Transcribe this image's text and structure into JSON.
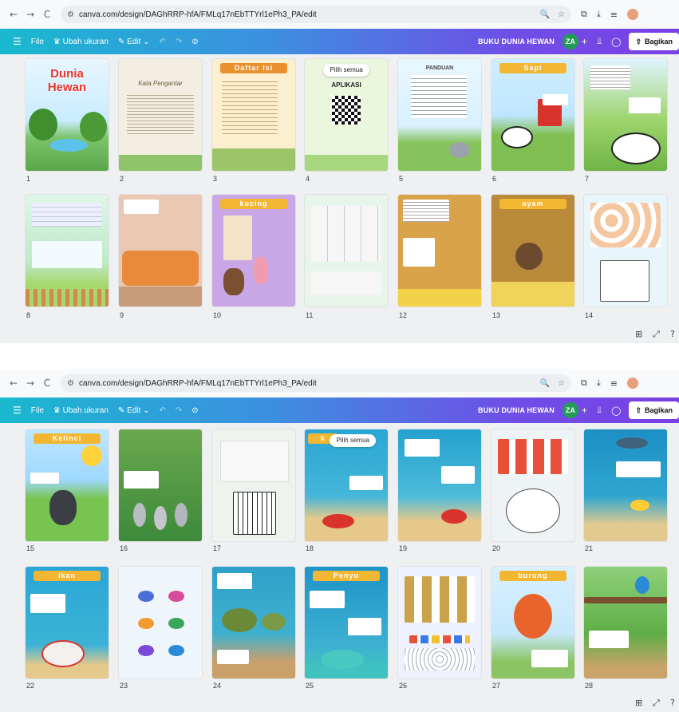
{
  "browser": {
    "url": "canva.com/design/DAGhRRP-hfA/FMLq17nEbTTYrl1ePh3_PA/edit",
    "url2": "canva.com/design/DAGhRRP-hfA/FMLq17nEbTTYrl1ePh3_PA/edit",
    "back_icon": "←",
    "forward_icon": "→",
    "reload_icon": "C",
    "tune_icon": "⚙",
    "zoom_icon": "🔍",
    "star_icon": "☆",
    "ext_icon": "⧉",
    "download_icon": "⤓",
    "tabs_icon": "≡"
  },
  "toolbar": {
    "menu_icon": "☰",
    "file": "File",
    "resize": "Ubah ukuran",
    "edit": "Edit",
    "undo": "↶",
    "redo": "↷",
    "saved_icon": "⊘",
    "doc_name": "BUKU DUNIA HEWAN",
    "avatar": "ZA",
    "plus": "+",
    "chart_icon": "⫫",
    "comment_icon": "◯",
    "share": "Bagikan",
    "share_icon": "⇧"
  },
  "screen1": {
    "pages": [
      {
        "num": "1",
        "title": "Dunia Hewan"
      },
      {
        "num": "2",
        "title": "Kata Pengantar"
      },
      {
        "num": "3",
        "title": "Daftar Isi"
      },
      {
        "num": "4",
        "button": "Pilih semua",
        "text": "APLIKASI"
      },
      {
        "num": "5",
        "title": "PANDUAN"
      },
      {
        "num": "6",
        "title": "Sapi"
      },
      {
        "num": "7",
        "title": ""
      },
      {
        "num": "8",
        "title": ""
      },
      {
        "num": "9",
        "title": ""
      },
      {
        "num": "10",
        "title": "kucing"
      },
      {
        "num": "11",
        "title": ""
      },
      {
        "num": "12",
        "title": ""
      },
      {
        "num": "13",
        "title": "ayam"
      },
      {
        "num": "14",
        "title": ""
      }
    ]
  },
  "screen2": {
    "pages": [
      {
        "num": "15",
        "title": "Kelinci"
      },
      {
        "num": "16",
        "title": ""
      },
      {
        "num": "17",
        "title": ""
      },
      {
        "num": "18",
        "title": "k",
        "button": "Pilih semua"
      },
      {
        "num": "19",
        "title": ""
      },
      {
        "num": "20",
        "title": ""
      },
      {
        "num": "21",
        "title": ""
      },
      {
        "num": "22",
        "title": "ikan"
      },
      {
        "num": "23",
        "title": ""
      },
      {
        "num": "24",
        "title": ""
      },
      {
        "num": "25",
        "title": "Penyu"
      },
      {
        "num": "26",
        "title": ""
      },
      {
        "num": "27",
        "title": "burung"
      },
      {
        "num": "28",
        "title": ""
      }
    ]
  },
  "footer": {
    "grid_icon": "⊞",
    "expand_icon": "⤢",
    "help_icon": "?"
  },
  "colors": {
    "toolbar_start": "#19b9cf",
    "toolbar_end": "#7b3fe4",
    "avatar": "#1f9d55"
  }
}
